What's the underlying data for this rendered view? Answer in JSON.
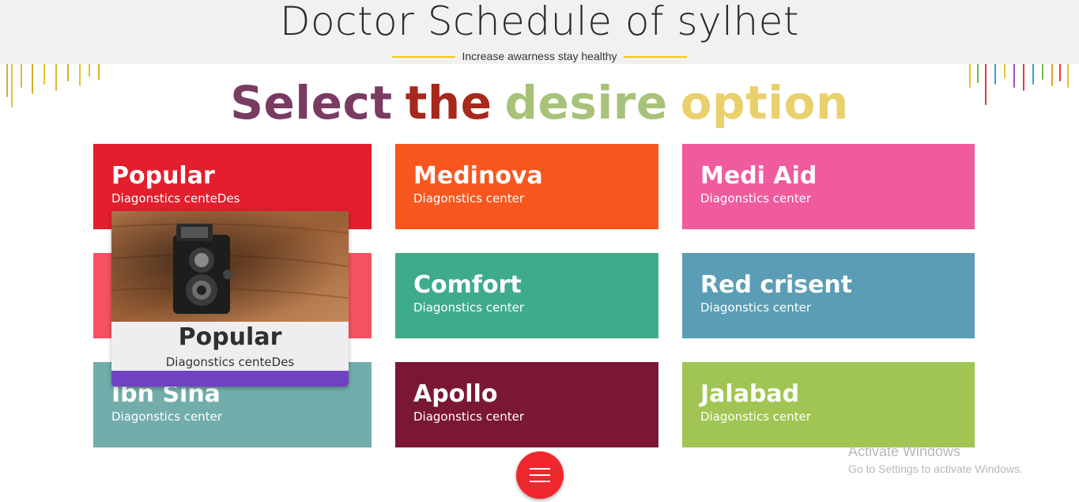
{
  "header": {
    "title": "Doctor Schedule of sylhet",
    "tagline": "Increase awarness stay healthy"
  },
  "heading": {
    "words": [
      "Select",
      "the",
      "desire",
      "option"
    ],
    "colors": [
      "#7a3b63",
      "#a8281b",
      "#a8c27a",
      "#ead06b"
    ]
  },
  "tiles": [
    {
      "name": "Popular",
      "subtitle": "Diagonstics centeDes",
      "color": "#e31e2d"
    },
    {
      "name": "Medinova",
      "subtitle": "Diagonstics center",
      "color": "#f7571f"
    },
    {
      "name": "Medi Aid",
      "subtitle": "Diagonstics center",
      "color": "#ef5b9c"
    },
    {
      "name": "",
      "subtitle": "",
      "color": "#f5515f"
    },
    {
      "name": "Comfort",
      "subtitle": "Diagonstics center",
      "color": "#3fab8d"
    },
    {
      "name": "Red crisent",
      "subtitle": "Diagonstics center",
      "color": "#5a9db5"
    },
    {
      "name": "Ibn Sina",
      "subtitle": "Diagonstics center",
      "color": "#72adab"
    },
    {
      "name": "Apollo",
      "subtitle": "Diagonstics center",
      "color": "#7a1733"
    },
    {
      "name": "Jalabad",
      "subtitle": "Diagonstics center",
      "color": "#a0c552"
    }
  ],
  "popup": {
    "name": "Popular",
    "subtitle": "Diagonstics centeDes",
    "image": "vintage-camera-photo",
    "bar_color": "#6f42c1"
  },
  "menu_button": {
    "icon": "hamburger-menu-icon",
    "color": "#f0282d"
  },
  "watermark": {
    "line1": "Activate Windows",
    "line2": "Go to Settings to activate Windows."
  }
}
